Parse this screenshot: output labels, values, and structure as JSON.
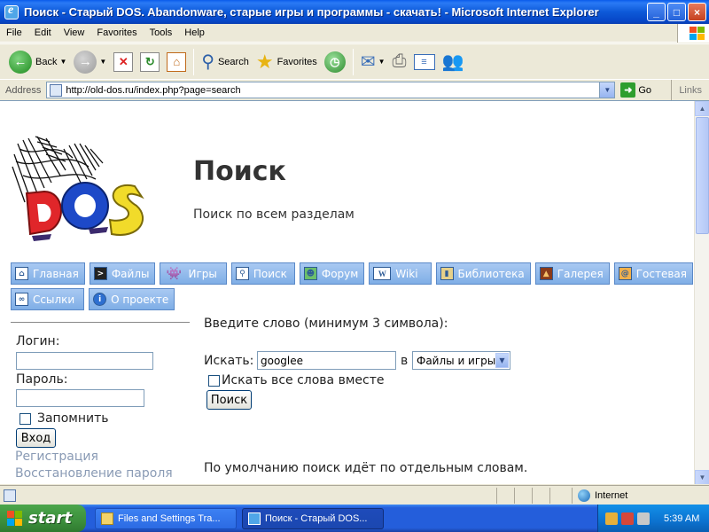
{
  "window": {
    "title": "Поиск - Старый DOS. Abandonware, старые игры и программы - скачать! - Microsoft Internet Explorer",
    "buttons": [
      "_",
      "□",
      "×"
    ]
  },
  "menu": [
    "File",
    "Edit",
    "View",
    "Favorites",
    "Tools",
    "Help"
  ],
  "toolbar": {
    "back": "Back",
    "search": "Search",
    "favorites": "Favorites"
  },
  "address": {
    "label": "Address",
    "url": "http://old-dos.ru/index.php?page=search",
    "go": "Go",
    "links": "Links"
  },
  "page": {
    "title": "Поиск",
    "subtitle": "Поиск по всем разделам",
    "nav_row1": [
      {
        "label": "Главная",
        "icon": "home-icon"
      },
      {
        "label": "Файлы",
        "icon": "terminal-icon"
      },
      {
        "label": "Игры",
        "icon": "invader-icon"
      },
      {
        "label": "Поиск",
        "icon": "magnifier-icon"
      },
      {
        "label": "Форум",
        "icon": "user-icon"
      },
      {
        "label": "Wiki",
        "icon": "wiki-icon"
      },
      {
        "label": "Библиотека",
        "icon": "book-icon"
      },
      {
        "label": "Галерея",
        "icon": "picture-icon"
      },
      {
        "label": "Гостевая",
        "icon": "guestbook-icon"
      }
    ],
    "nav_row2": [
      {
        "label": "Ссылки",
        "icon": "link-icon"
      },
      {
        "label": "О проекте",
        "icon": "info-icon"
      }
    ],
    "login": {
      "login_label": "Логин:",
      "password_label": "Пароль:",
      "remember": "Запомнить",
      "submit": "Вход",
      "register": "Регистрация",
      "restore": "Восстановление пароля"
    },
    "search": {
      "prompt": "Введите слово (минимум 3 символа):",
      "label": "Искать:",
      "value": "googlee",
      "in": "в",
      "section": "Файлы и игры",
      "all_words": "Искать все слова вместе",
      "button": "Поиск",
      "note": "По умолчанию поиск идёт по отдельным словам."
    }
  },
  "status": {
    "zone": "Internet"
  },
  "taskbar": {
    "start": "start",
    "items": [
      "Files and Settings Tra...",
      "Поиск - Старый DOS..."
    ],
    "clock": "5:39 AM"
  }
}
